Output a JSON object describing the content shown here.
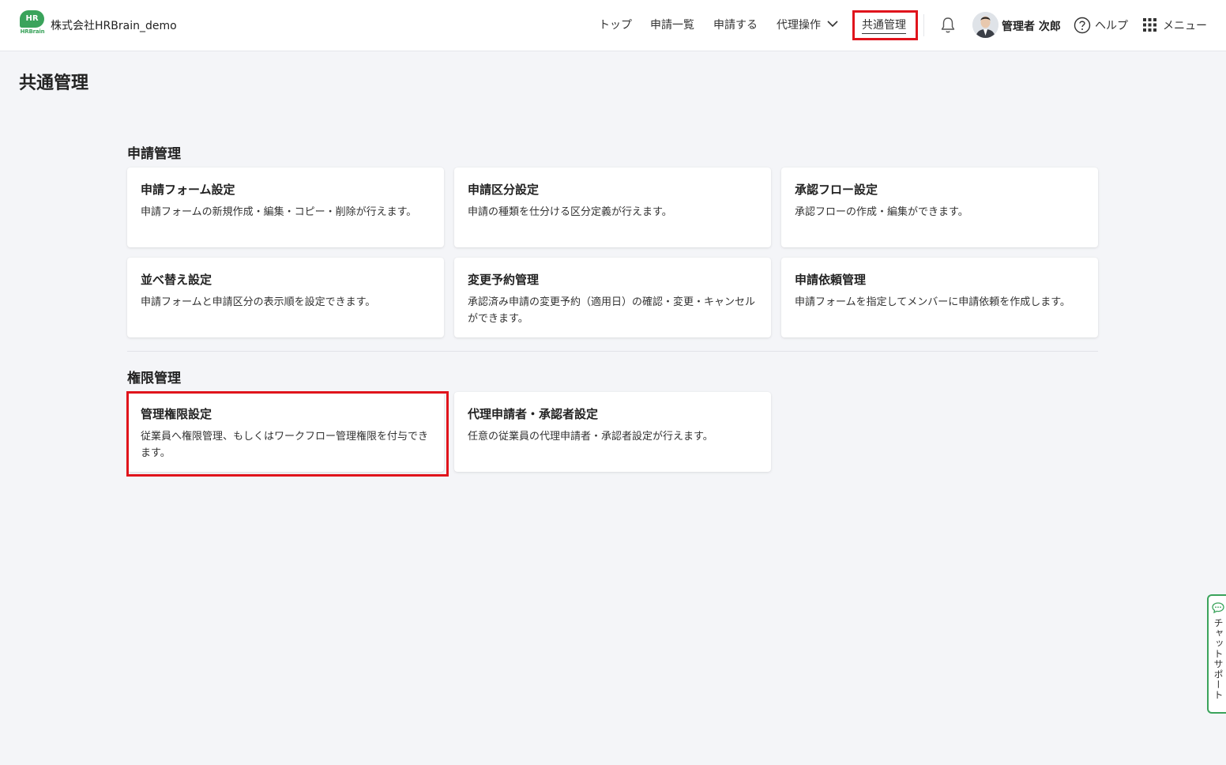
{
  "header": {
    "logo_text": "HR",
    "logo_subtext": "HRBrain",
    "company": "株式会社HRBrain_demo",
    "nav": {
      "top": "トップ",
      "list": "申請一覧",
      "apply": "申請する",
      "proxy": "代理操作",
      "common": "共通管理"
    },
    "user_name": "管理者 次郎",
    "help": "ヘルプ",
    "menu": "メニュー"
  },
  "page": {
    "title": "共通管理"
  },
  "sections": {
    "application": {
      "title": "申請管理",
      "cards": [
        {
          "title": "申請フォーム設定",
          "desc": "申請フォームの新規作成・編集・コピー・削除が行えます。"
        },
        {
          "title": "申請区分設定",
          "desc": "申請の種類を仕分ける区分定義が行えます。"
        },
        {
          "title": "承認フロー設定",
          "desc": "承認フローの作成・編集ができます。"
        },
        {
          "title": "並べ替え設定",
          "desc": "申請フォームと申請区分の表示順を設定できます。"
        },
        {
          "title": "変更予約管理",
          "desc": "承認済み申請の変更予約（適用日）の確認・変更・キャンセルができます。"
        },
        {
          "title": "申請依頼管理",
          "desc": "申請フォームを指定してメンバーに申請依頼を作成します。"
        }
      ]
    },
    "permission": {
      "title": "権限管理",
      "cards": [
        {
          "title": "管理権限設定",
          "desc": "従業員へ権限管理、もしくはワークフロー管理権限を付与できます。"
        },
        {
          "title": "代理申請者・承認者設定",
          "desc": "任意の従業員の代理申請者・承認者設定が行えます。"
        }
      ]
    }
  },
  "chat_support": {
    "label": "チャットサポート"
  },
  "colors": {
    "brand_green": "#3aa35b",
    "highlight_red": "#e0141c",
    "background": "#f4f5f8"
  }
}
